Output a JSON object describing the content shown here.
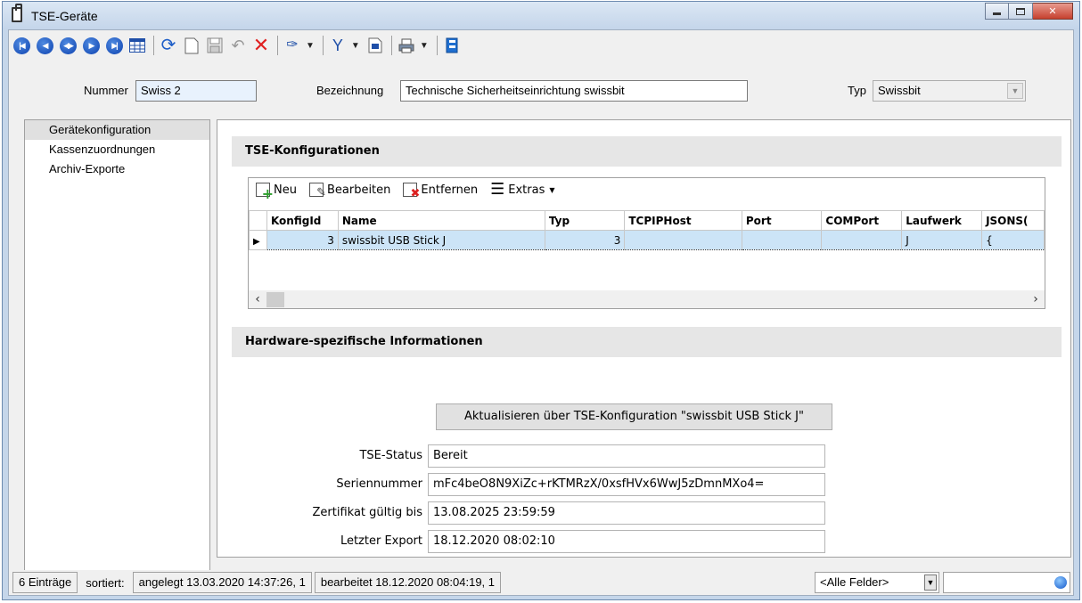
{
  "window": {
    "title": "TSE-Geräte"
  },
  "toolbar": {
    "nav_buttons": [
      "first-record",
      "previous-page",
      "previous-record",
      "next-record",
      "last-record"
    ],
    "icons": [
      "table-view-icon",
      "refresh-icon",
      "new-document-icon",
      "save-icon",
      "undo-icon",
      "delete-icon",
      "tools-icon",
      "filter-icon",
      "bookmark-icon",
      "print-icon",
      "clipboard-icon"
    ]
  },
  "header": {
    "nummer_label": "Nummer",
    "nummer_value": "Swiss 2",
    "bezeichnung_label": "Bezeichnung",
    "bezeichnung_value": "Technische Sicherheitseinrichtung swissbit",
    "typ_label": "Typ",
    "typ_value": "Swissbit"
  },
  "sidebar": {
    "items": [
      {
        "label": "Gerätekonfiguration",
        "selected": true
      },
      {
        "label": "Kassenzuordnungen",
        "selected": false
      },
      {
        "label": "Archiv-Exporte",
        "selected": false
      }
    ]
  },
  "konfig": {
    "title": "TSE-Konfigurationen",
    "toolbar": {
      "new": "Neu",
      "edit": "Bearbeiten",
      "remove": "Entfernen",
      "extras": "Extras"
    },
    "columns": [
      "KonfigId",
      "Name",
      "Typ",
      "TCPIPHost",
      "Port",
      "COMPort",
      "Laufwerk",
      "JSONS("
    ],
    "rows": [
      [
        "3",
        "swissbit USB Stick J",
        "3",
        "",
        "",
        "",
        "J",
        "{"
      ]
    ]
  },
  "hardware": {
    "title": "Hardware-spezifische Informationen",
    "update_button": "Aktualisieren über TSE-Konfiguration \"swissbit USB Stick J\"",
    "fields": [
      {
        "label": "TSE-Status",
        "value": "Bereit"
      },
      {
        "label": "Seriennummer",
        "value": "mFc4beO8N9XiZc+rKTMRzX/0xsfHVx6WwJ5zDmnMXo4="
      },
      {
        "label": "Zertifikat gültig bis",
        "value": "13.08.2025 23:59:59"
      },
      {
        "label": "Letzter Export",
        "value": "18.12.2020 08:02:10"
      }
    ]
  },
  "statusbar": {
    "count": "6 Einträge",
    "sorted": "sortiert:",
    "created": "angelegt 13.03.2020 14:37:26, 1",
    "edited": "bearbeitet 18.12.2020 08:04:19, 1",
    "field_filter": "<Alle Felder>"
  }
}
